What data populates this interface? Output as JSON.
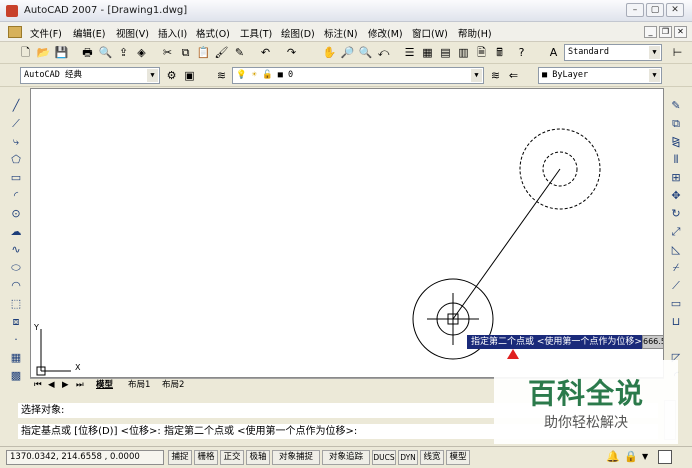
{
  "window": {
    "title": "AutoCAD 2007 - [Drawing1.dwg]",
    "min": "–",
    "max": "▢",
    "close": "✕"
  },
  "menu": {
    "items": [
      "文件(F)",
      "编辑(E)",
      "视图(V)",
      "插入(I)",
      "格式(O)",
      "工具(T)",
      "绘图(D)",
      "标注(N)",
      "修改(M)",
      "窗口(W)",
      "帮助(H)"
    ],
    "doc_min": "_",
    "doc_restore": "❐",
    "doc_close": "✕"
  },
  "toolbar": {
    "text_style": "Standard",
    "workspace": "AutoCAD 经典",
    "layer": "0",
    "color": "ByLayer"
  },
  "drawing": {
    "tooltip": "指定第二个点或 <使用第一个点作为位移>:",
    "dyn_value": "666.5",
    "axis_y": "Y",
    "axis_x": "X"
  },
  "tabs": {
    "model": "模型",
    "layout1": "布局1",
    "layout2": "布局2"
  },
  "command": {
    "line1": "选择对象:",
    "line2": "指定基点或 [位移(D)] <位移>:  指定第二个点或 <使用第一个点作为位移>:"
  },
  "status": {
    "coords": "1370.0342, 214.6558 , 0.0000",
    "buttons": [
      "捕捉",
      "栅格",
      "正交",
      "极轴",
      "对象捕捉",
      "对象追踪",
      "DUCS",
      "DYN",
      "线宽",
      "模型"
    ]
  },
  "watermark": {
    "title": "百科全说",
    "subtitle": "助你轻松解决"
  },
  "colors": {
    "tooltip_bg": "#1a2a7a",
    "canvas_bg": "#ffffff",
    "watermark_green": "#2b7a4b",
    "marker_red": "#e02020"
  }
}
